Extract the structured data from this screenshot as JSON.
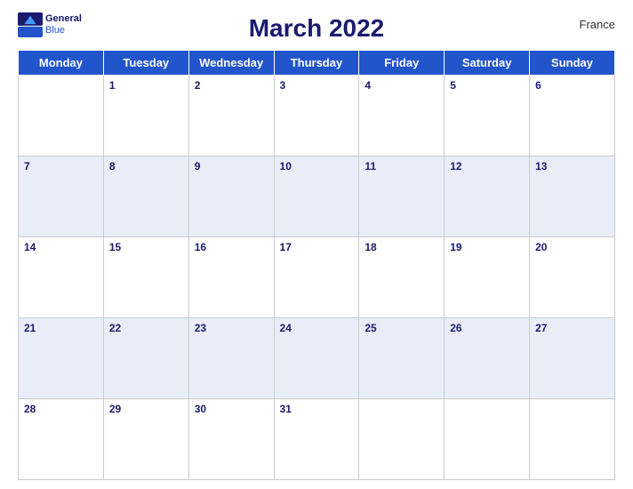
{
  "header": {
    "title": "March 2022",
    "country": "France",
    "logo_line1": "General",
    "logo_line2": "Blue"
  },
  "weekdays": [
    "Monday",
    "Tuesday",
    "Wednesday",
    "Thursday",
    "Friday",
    "Saturday",
    "Sunday"
  ],
  "weeks": [
    [
      "",
      "1",
      "2",
      "3",
      "4",
      "5",
      "6"
    ],
    [
      "7",
      "8",
      "9",
      "10",
      "11",
      "12",
      "13"
    ],
    [
      "14",
      "15",
      "16",
      "17",
      "18",
      "19",
      "20"
    ],
    [
      "21",
      "22",
      "23",
      "24",
      "25",
      "26",
      "27"
    ],
    [
      "28",
      "29",
      "30",
      "31",
      "",
      "",
      ""
    ]
  ]
}
